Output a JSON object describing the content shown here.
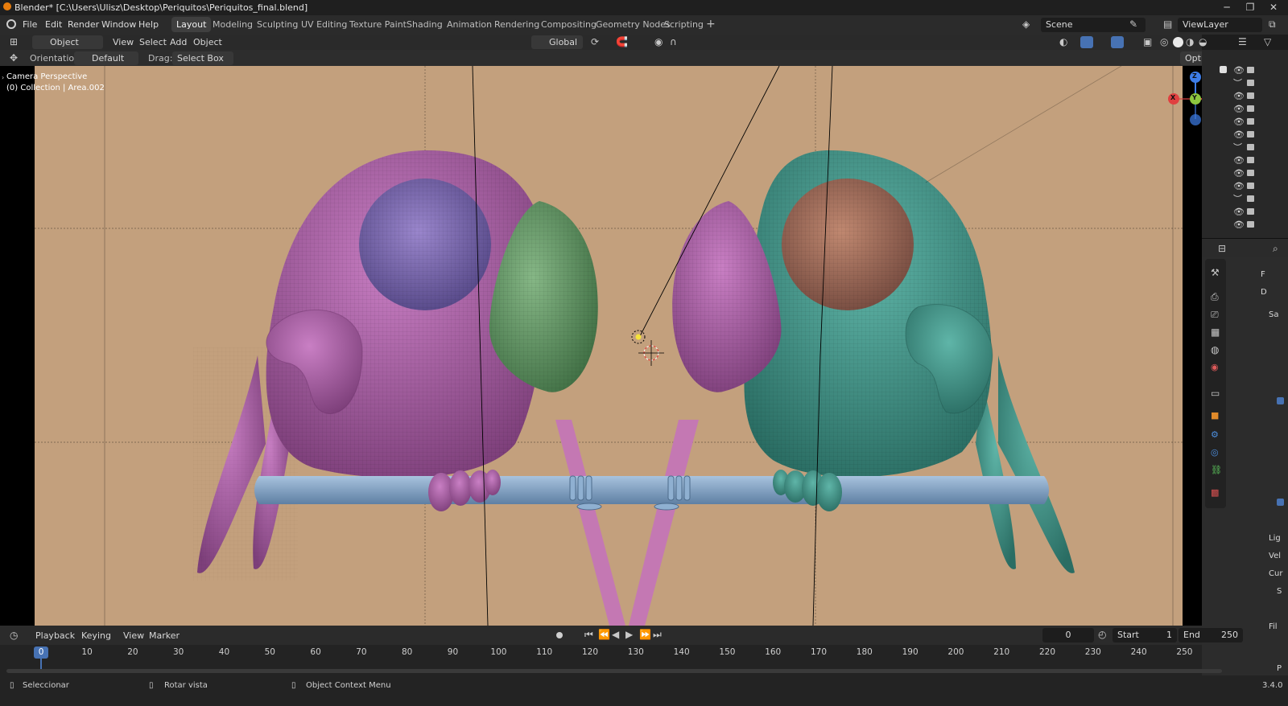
{
  "window": {
    "title": "Blender* [C:\\Users\\Ulisz\\Desktop\\Periquitos\\Periquitos_final.blend]"
  },
  "menu": [
    "File",
    "Edit",
    "Render",
    "Window",
    "Help"
  ],
  "workspaces": [
    "Layout",
    "Modeling",
    "Sculpting",
    "UV Editing",
    "Texture Paint",
    "Shading",
    "Animation",
    "Rendering",
    "Compositing",
    "Geometry Nodes",
    "Scripting"
  ],
  "workspace_add": "+",
  "scene": {
    "label": "Scene",
    "view_layer": "ViewLayer"
  },
  "header": {
    "mode": "Object Mode",
    "view": "View",
    "select": "Select",
    "add": "Add",
    "object": "Object",
    "transform_orientation": "Global"
  },
  "tool_settings": {
    "orientation_label": "Orientation:",
    "orientation_value": "Default",
    "drag_label": "Drag:",
    "drag_value": "Select Box",
    "options": "Options"
  },
  "viewport": {
    "perspective": "Camera Perspective",
    "collection": "(0) Collection | Area.002"
  },
  "gizmo": {
    "x": "X",
    "y": "Y",
    "z": "Z"
  },
  "properties": {
    "labels": [
      "F",
      "D",
      "Sa",
      "Lig",
      "Vel",
      "Cur",
      "S",
      "Fil",
      "P"
    ]
  },
  "timeline": {
    "menus": [
      "Playback",
      "Keying",
      "View",
      "Marker"
    ],
    "current_frame": "0",
    "start_label": "Start",
    "start_value": "1",
    "end_label": "End",
    "end_value": "250",
    "ticks": [
      "0",
      "10",
      "20",
      "30",
      "40",
      "50",
      "60",
      "70",
      "80",
      "90",
      "100",
      "110",
      "120",
      "130",
      "140",
      "150",
      "160",
      "170",
      "180",
      "190",
      "200",
      "210",
      "220",
      "230",
      "240",
      "250"
    ]
  },
  "status": {
    "select": "Seleccionar",
    "rotate": "Rotar vista",
    "context": "Object Context Menu",
    "version": "3.4.0"
  },
  "colors": {
    "accent": "#4772b3",
    "cam_bg": "#c3a07d",
    "parrot_purple": "#b56bb0",
    "parrot_teal": "#4fa69a",
    "beak_green": "#6fa070",
    "perch": "#8fb0d1"
  }
}
